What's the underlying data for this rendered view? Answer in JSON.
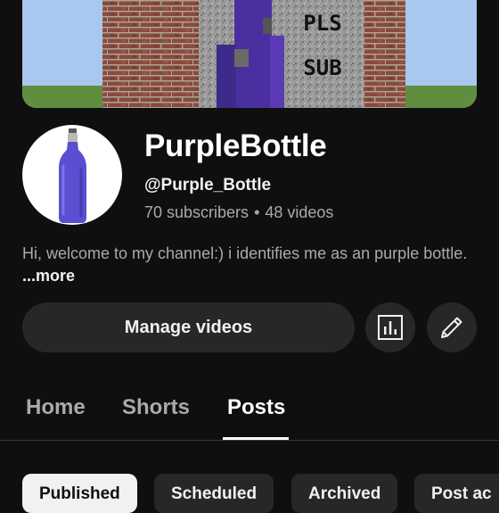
{
  "channel": {
    "name": "PurpleBottle",
    "handle": "@Purple_Bottle",
    "subscribers": "70 subscribers",
    "separator": "•",
    "videos": "48 videos",
    "description": "Hi, welcome to my channel:) i identifies me as an purple bottle.",
    "more_label": "...more"
  },
  "banner": {
    "sign_line1": "PLS",
    "sign_line2": "SUB"
  },
  "actions": {
    "manage_videos_label": "Manage videos",
    "analytics_icon": "analytics-icon",
    "edit_icon": "pencil-icon"
  },
  "tabs": [
    {
      "label": "Home",
      "active": false
    },
    {
      "label": "Shorts",
      "active": false
    },
    {
      "label": "Posts",
      "active": true
    }
  ],
  "filters": [
    {
      "label": "Published",
      "selected": true
    },
    {
      "label": "Scheduled",
      "selected": false
    },
    {
      "label": "Archived",
      "selected": false
    },
    {
      "label": "Post ac",
      "selected": false
    }
  ],
  "colors": {
    "background": "#0f0f0f",
    "surface": "#272727",
    "bottle_purple": "#5a4fd0",
    "secondary_text": "#aaaaaa"
  }
}
